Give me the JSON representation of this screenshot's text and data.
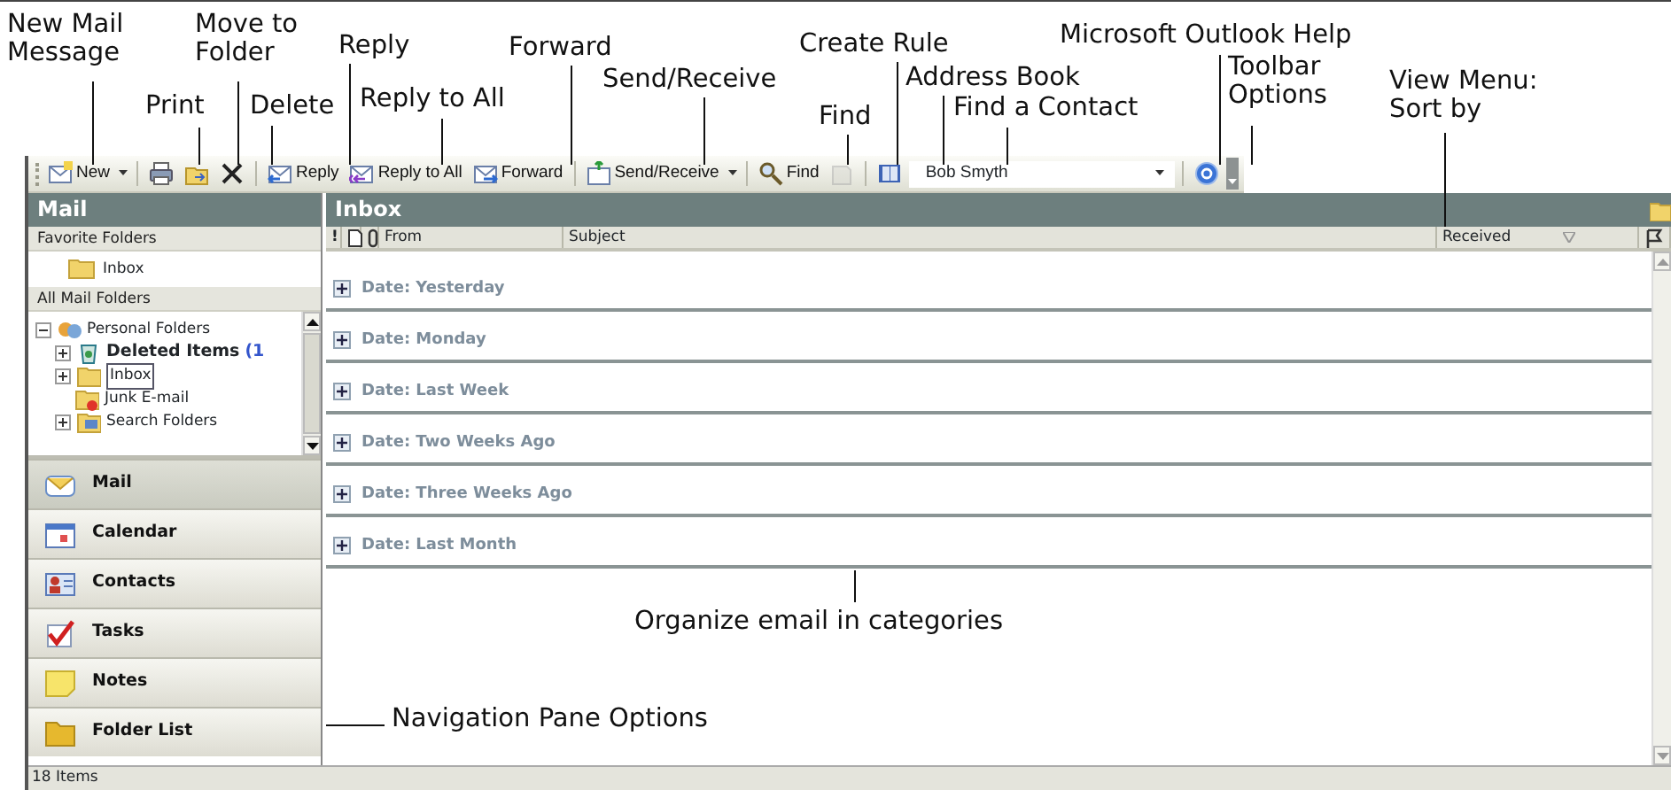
{
  "callouts": [
    {
      "text": "New Mail Message"
    },
    {
      "text": "Print"
    },
    {
      "text": "Move to Folder"
    },
    {
      "text": "Delete"
    },
    {
      "text": "Reply"
    },
    {
      "text": "Reply to All"
    },
    {
      "text": "Forward"
    },
    {
      "text": "Send/Receive"
    },
    {
      "text": "Create Rule"
    },
    {
      "text": "Find"
    },
    {
      "text": "Address Book"
    },
    {
      "text": "Find a Contact"
    },
    {
      "text": "Microsoft Outlook Help"
    },
    {
      "text": "Toolbar Options"
    },
    {
      "text": "View Menu: Sort by"
    },
    {
      "text": "Organize email in categories"
    },
    {
      "text": "Navigation Pane Options"
    }
  ],
  "toolbar": {
    "items": [
      {
        "kind": "split",
        "label": "New"
      },
      {
        "kind": "separator"
      },
      {
        "kind": "icon"
      },
      {
        "kind": "icon"
      },
      {
        "kind": "icon"
      },
      {
        "kind": "separator"
      },
      {
        "kind": "button",
        "label": "Reply"
      },
      {
        "kind": "button",
        "label": "Reply to All"
      },
      {
        "kind": "button",
        "label": "Forward"
      },
      {
        "kind": "separator"
      },
      {
        "kind": "split",
        "label": "Send/Receive"
      },
      {
        "kind": "separator"
      },
      {
        "kind": "button",
        "label": "Find"
      },
      {
        "kind": "icon",
        "disabled": true
      },
      {
        "kind": "separator"
      },
      {
        "kind": "icon"
      },
      {
        "kind": "combo",
        "value": "Bob Smyth"
      },
      {
        "kind": "separator"
      },
      {
        "kind": "icon"
      },
      {
        "kind": "overflow"
      }
    ]
  },
  "navigation_pane": {
    "title": "Mail",
    "favorite_folders": {
      "heading": "Favorite Folders",
      "items": [
        {
          "name": "Inbox"
        }
      ]
    },
    "all_mail_folders": {
      "heading": "All Mail Folders",
      "tree": [
        {
          "name": "Personal Folders",
          "expanded": true,
          "selected": false,
          "children": [
            {
              "name": "Deleted Items",
              "count": "(1",
              "unread": true,
              "expanded": false,
              "selected": false
            },
            {
              "name": "Inbox",
              "unread": false,
              "expanded": false,
              "selected": true
            },
            {
              "name": "Junk E-mail",
              "unread": false,
              "selected": false
            },
            {
              "name": "Search Folders",
              "unread": false,
              "expanded": false,
              "selected": false
            }
          ]
        }
      ]
    },
    "buttons": [
      {
        "label": "Mail",
        "selected": true
      },
      {
        "label": "Calendar",
        "selected": false
      },
      {
        "label": "Contacts",
        "selected": false
      },
      {
        "label": "Tasks",
        "selected": false
      },
      {
        "label": "Notes",
        "selected": false
      },
      {
        "label": "Folder List",
        "selected": false
      }
    ]
  },
  "message_list": {
    "title": "Inbox",
    "columns": [
      {
        "kind": "text",
        "label": "!"
      },
      {
        "kind": "icon"
      },
      {
        "kind": "icon"
      },
      {
        "kind": "text",
        "label": "From"
      },
      {
        "kind": "text",
        "label": "Subject"
      },
      {
        "kind": "text",
        "label": "Received",
        "sorted": true
      },
      {
        "kind": "icon"
      }
    ],
    "groups": [
      {
        "label": "Date: Yesterday",
        "expanded": false
      },
      {
        "label": "Date: Monday",
        "expanded": false
      },
      {
        "label": "Date: Last Week",
        "expanded": false
      },
      {
        "label": "Date: Two Weeks Ago",
        "expanded": false
      },
      {
        "label": "Date: Three Weeks Ago",
        "expanded": false
      },
      {
        "label": "Date: Last Month",
        "expanded": false
      }
    ]
  },
  "status_bar": {
    "text": "18 Items"
  }
}
